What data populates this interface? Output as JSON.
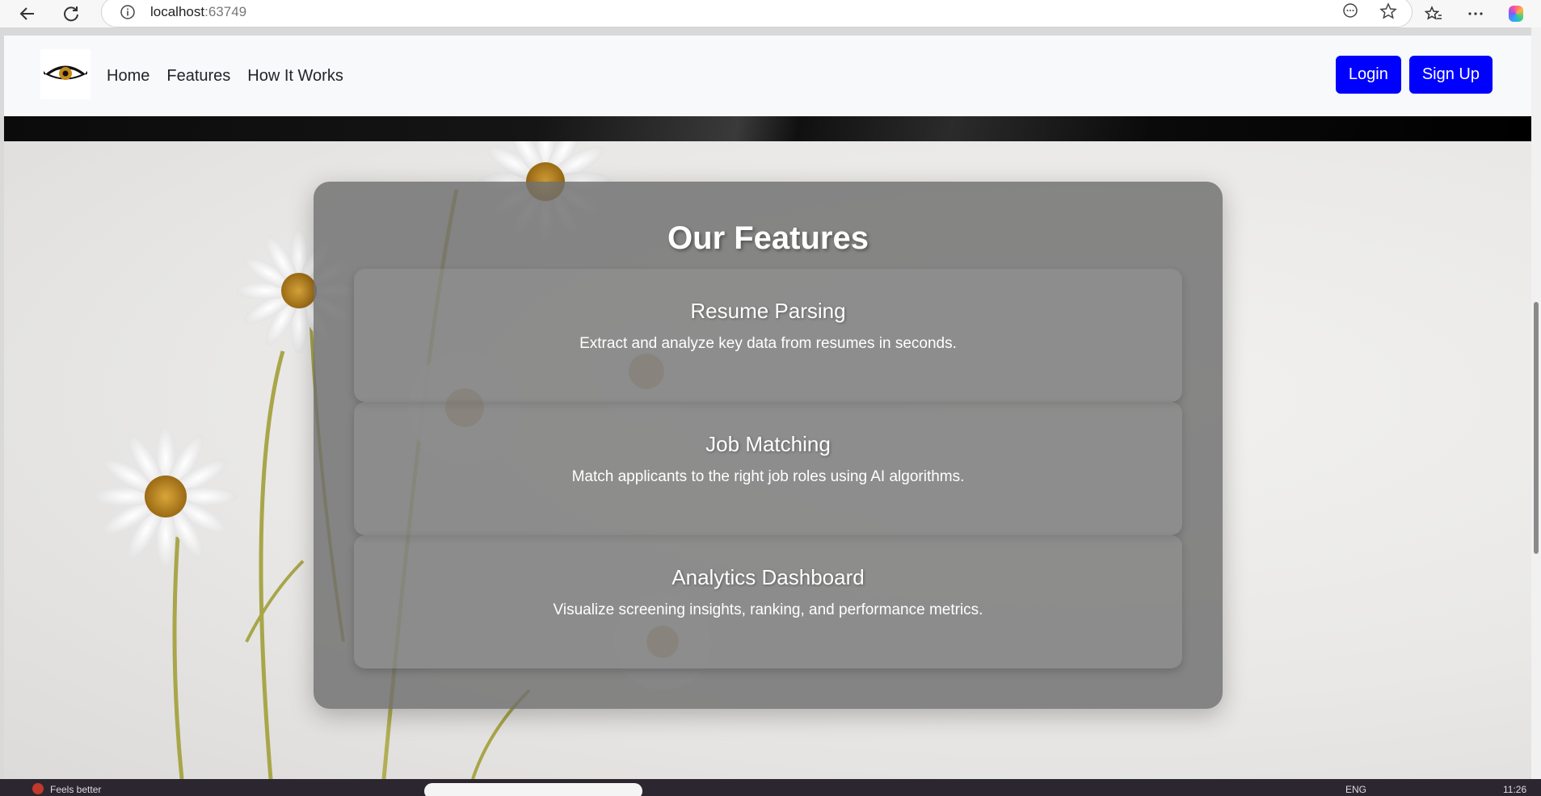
{
  "browser": {
    "url_host": "localhost",
    "url_port": ":63749"
  },
  "site": {
    "nav": [
      {
        "label": "Home"
      },
      {
        "label": "Features"
      },
      {
        "label": "How It Works"
      }
    ],
    "login_label": "Login",
    "signup_label": "Sign Up",
    "accent_color": "#0000ff"
  },
  "features": {
    "title": "Our Features",
    "cards": [
      {
        "title": "Resume Parsing",
        "desc": "Extract and analyze key data from resumes in seconds."
      },
      {
        "title": "Job Matching",
        "desc": "Match applicants to the right job roles using AI algorithms."
      },
      {
        "title": "Analytics Dashboard",
        "desc": "Visualize screening insights, ranking, and performance metrics."
      }
    ]
  },
  "taskbar": {
    "weather_text": "Feels better",
    "lang": "ENG",
    "time": "11:26"
  }
}
